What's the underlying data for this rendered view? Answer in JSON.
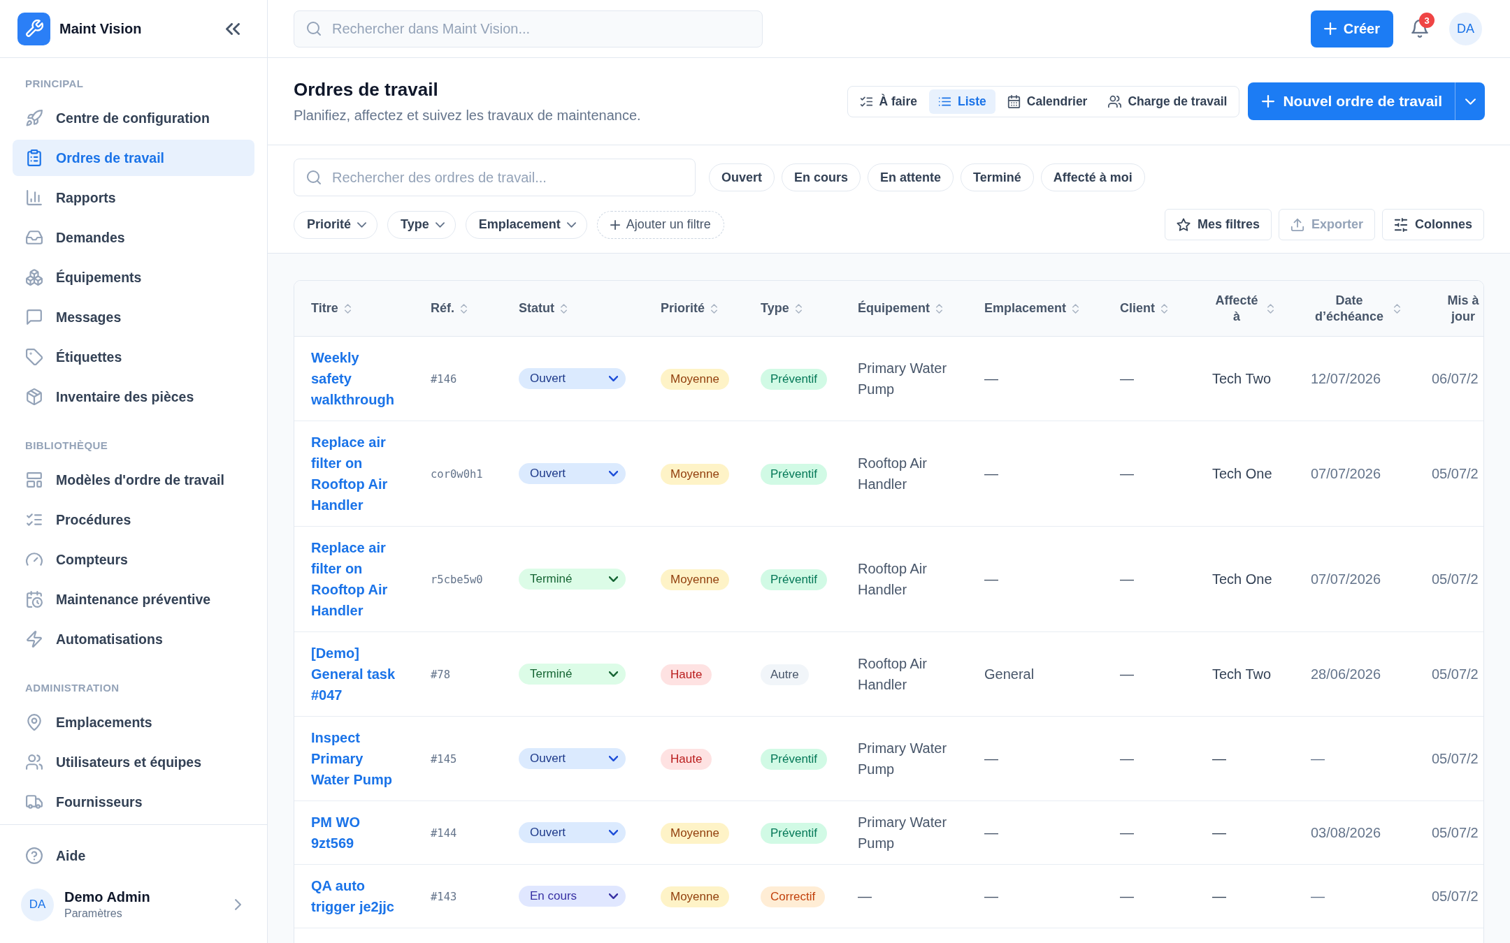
{
  "sidebar": {
    "brand": {
      "name": "Maint Vision"
    },
    "sections": [
      {
        "heading": "PRINCIPAL",
        "items": [
          {
            "label": "Centre de configuration",
            "selected": false
          },
          {
            "label": "Ordres de travail",
            "selected": true
          },
          {
            "label": "Rapports",
            "selected": false
          },
          {
            "label": "Demandes",
            "selected": false
          },
          {
            "label": "Équipements",
            "selected": false
          },
          {
            "label": "Messages",
            "selected": false
          },
          {
            "label": "Étiquettes",
            "selected": false
          },
          {
            "label": "Inventaire des pièces",
            "selected": false
          }
        ]
      },
      {
        "heading": "BIBLIOTHÈQUE",
        "items": [
          {
            "label": "Modèles d'ordre de travail",
            "selected": false
          },
          {
            "label": "Procédures",
            "selected": false
          },
          {
            "label": "Compteurs",
            "selected": false
          },
          {
            "label": "Maintenance préventive",
            "selected": false
          },
          {
            "label": "Automatisations",
            "selected": false
          }
        ]
      },
      {
        "heading": "ADMINISTRATION",
        "items": [
          {
            "label": "Emplacements",
            "selected": false
          },
          {
            "label": "Utilisateurs et équipes",
            "selected": false
          },
          {
            "label": "Fournisseurs",
            "selected": false
          }
        ]
      }
    ],
    "footer_items": [
      {
        "label": "Aide",
        "selected": false
      }
    ],
    "user": {
      "initials": "DA",
      "name": "Demo Admin",
      "subtitle": "Paramètres"
    }
  },
  "topbar": {
    "search": {
      "placeholder": "Rechercher dans Maint Vision..."
    },
    "create_button": "Créer",
    "notifications": {
      "count": "3"
    },
    "avatar": "DA"
  },
  "page_header": {
    "title": "Ordres de travail",
    "subtitle": "Planifiez, affectez et suivez les travaux de maintenance.",
    "views": [
      {
        "label": "À faire",
        "selected": false
      },
      {
        "label": "Liste",
        "selected": true
      },
      {
        "label": "Calendrier",
        "selected": false
      },
      {
        "label": "Charge de travail",
        "selected": false
      }
    ],
    "primary_button": "Nouvel ordre de travail"
  },
  "filters": {
    "search": {
      "placeholder": "Rechercher des ordres de travail..."
    },
    "quick_filters": [
      {
        "label": "Ouvert",
        "selected": false
      },
      {
        "label": "En cours",
        "selected": false
      },
      {
        "label": "En attente",
        "selected": false
      },
      {
        "label": "Terminé",
        "selected": false
      },
      {
        "label": "Affecté à moi",
        "selected": false
      }
    ],
    "dropdowns": [
      "Priorité",
      "Type",
      "Emplacement"
    ],
    "add_filter": "Ajouter un filtre",
    "actions": [
      {
        "label": "Mes filtres",
        "disabled": false
      },
      {
        "label": "Exporter",
        "disabled": true
      },
      {
        "label": "Colonnes",
        "disabled": false
      }
    ]
  },
  "table": {
    "columns": [
      {
        "label": "Titre",
        "sortable": true
      },
      {
        "label": "Réf.",
        "sortable": true
      },
      {
        "label": "Statut",
        "sortable": true
      },
      {
        "label": "Priorité",
        "sortable": true
      },
      {
        "label": "Type",
        "sortable": true
      },
      {
        "label": "Équipement",
        "sortable": true
      },
      {
        "label": "Emplacement",
        "sortable": true
      },
      {
        "label": "Client",
        "sortable": true
      },
      {
        "label": "Affecté à",
        "sortable": true
      },
      {
        "label": "Date d’échéance",
        "sortable": true
      },
      {
        "label": "Mis à jour",
        "sortable": false
      }
    ],
    "rows": [
      {
        "title": "Weekly safety walkthrough",
        "ref": "#146",
        "status": {
          "label": "Ouvert",
          "kind": "open"
        },
        "priority": {
          "label": "Moyenne",
          "kind": "medium"
        },
        "type": {
          "label": "Préventif",
          "kind": "preventive"
        },
        "equipment": "Primary Water Pump",
        "location": "—",
        "client": "—",
        "assignee": "Tech Two",
        "due_date": "12/07/2026",
        "updated": "06/07/2"
      },
      {
        "title": "Replace air filter on Rooftop Air Handler",
        "ref": "cor0w0h1",
        "status": {
          "label": "Ouvert",
          "kind": "open"
        },
        "priority": {
          "label": "Moyenne",
          "kind": "medium"
        },
        "type": {
          "label": "Préventif",
          "kind": "preventive"
        },
        "equipment": "Rooftop Air Handler",
        "location": "—",
        "client": "—",
        "assignee": "Tech One",
        "due_date": "07/07/2026",
        "updated": "05/07/2"
      },
      {
        "title": "Replace air filter on Rooftop Air Handler",
        "ref": "r5cbe5w0",
        "status": {
          "label": "Terminé",
          "kind": "done"
        },
        "priority": {
          "label": "Moyenne",
          "kind": "medium"
        },
        "type": {
          "label": "Préventif",
          "kind": "preventive"
        },
        "equipment": "Rooftop Air Handler",
        "location": "—",
        "client": "—",
        "assignee": "Tech One",
        "due_date": "07/07/2026",
        "updated": "05/07/2"
      },
      {
        "title": "[Demo] General task #047",
        "ref": "#78",
        "status": {
          "label": "Terminé",
          "kind": "done"
        },
        "priority": {
          "label": "Haute",
          "kind": "high"
        },
        "type": {
          "label": "Autre",
          "kind": "other"
        },
        "equipment": "Rooftop Air Handler",
        "location": "General",
        "client": "—",
        "assignee": "Tech Two",
        "due_date": "28/06/2026",
        "updated": "05/07/2"
      },
      {
        "title": "Inspect Primary Water Pump",
        "ref": "#145",
        "status": {
          "label": "Ouvert",
          "kind": "open"
        },
        "priority": {
          "label": "Haute",
          "kind": "high"
        },
        "type": {
          "label": "Préventif",
          "kind": "preventive"
        },
        "equipment": "Primary Water Pump",
        "location": "—",
        "client": "—",
        "assignee": "—",
        "due_date": "—",
        "updated": "05/07/2"
      },
      {
        "title": "PM WO 9zt569",
        "ref": "#144",
        "status": {
          "label": "Ouvert",
          "kind": "open"
        },
        "priority": {
          "label": "Moyenne",
          "kind": "medium"
        },
        "type": {
          "label": "Préventif",
          "kind": "preventive"
        },
        "equipment": "Primary Water Pump",
        "location": "—",
        "client": "—",
        "assignee": "—",
        "due_date": "03/08/2026",
        "updated": "05/07/2"
      },
      {
        "title": "QA auto trigger je2jjc",
        "ref": "#143",
        "status": {
          "label": "En cours",
          "kind": "in_progress"
        },
        "priority": {
          "label": "Moyenne",
          "kind": "medium"
        },
        "type": {
          "label": "Correctif",
          "kind": "corrective"
        },
        "equipment": "—",
        "location": "—",
        "client": "—",
        "assignee": "—",
        "due_date": "—",
        "updated": "05/07/2"
      }
    ]
  }
}
